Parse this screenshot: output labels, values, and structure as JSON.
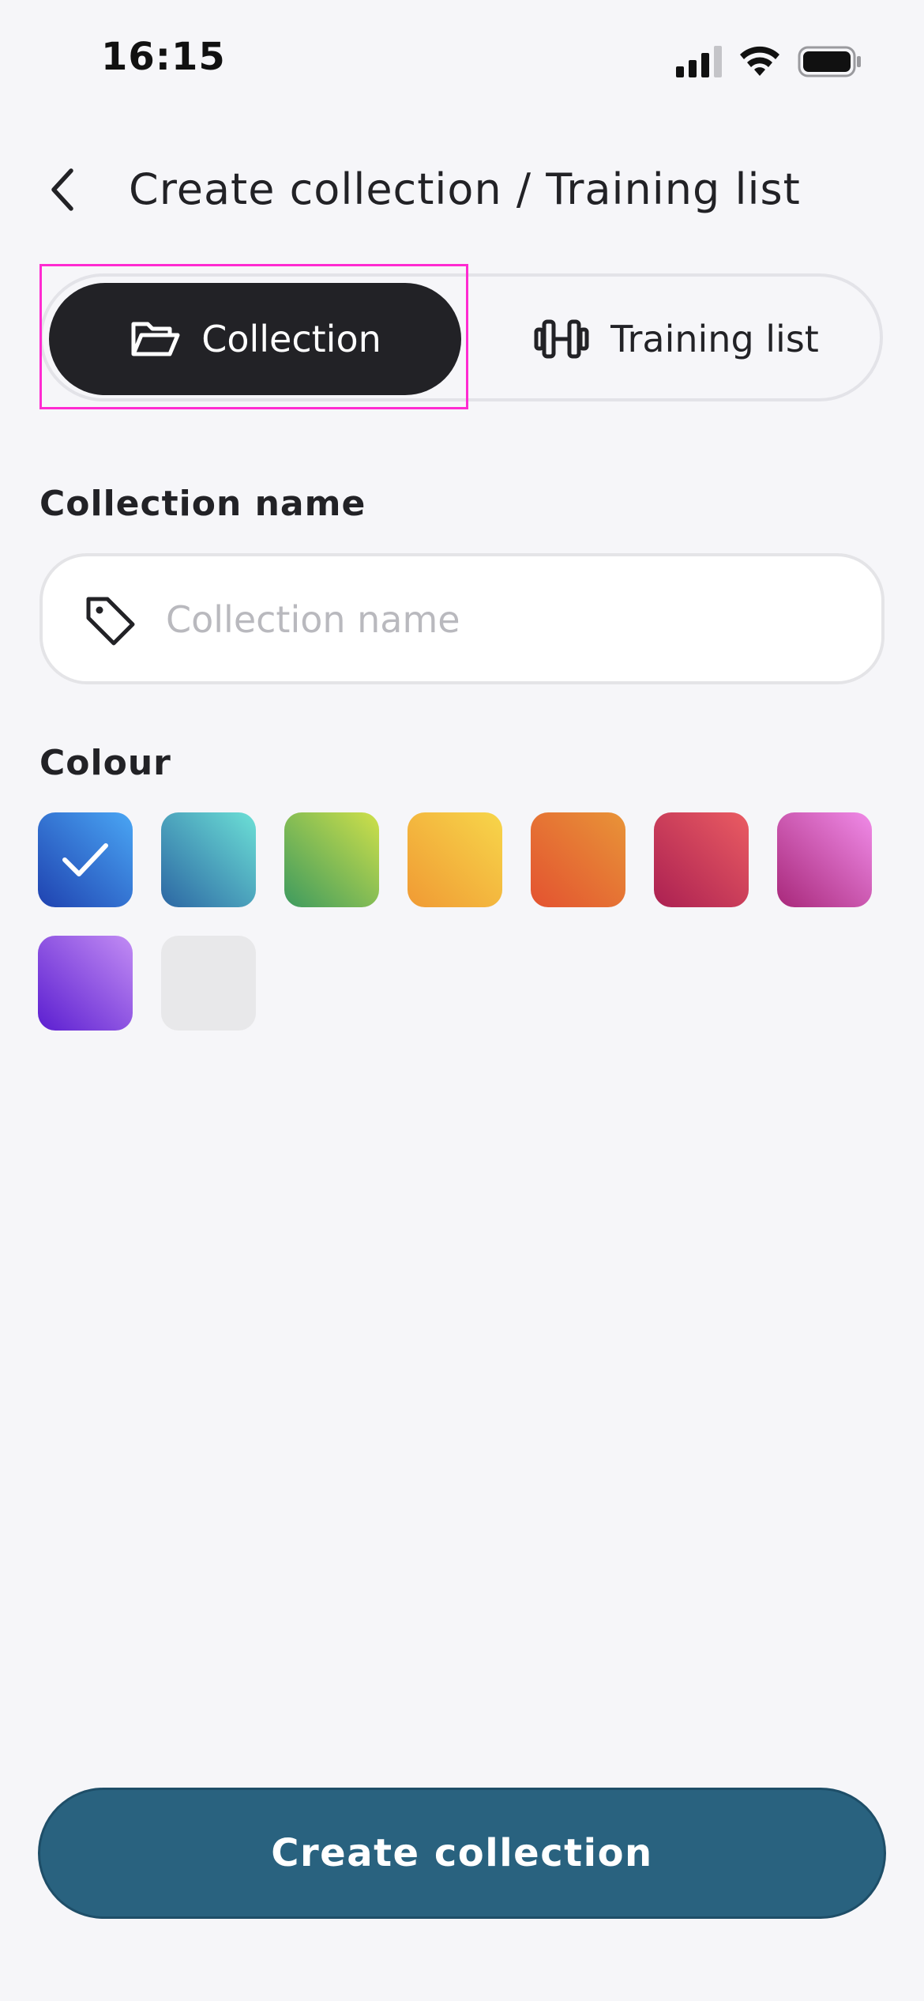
{
  "status_bar": {
    "time": "16:15",
    "icons": [
      "cellular-signal-icon",
      "wifi-icon",
      "battery-icon"
    ]
  },
  "header": {
    "title": "Create collection / Training list",
    "back_icon": "chevron-left-icon"
  },
  "segmented_control": {
    "selected": "collection",
    "options": [
      {
        "label": "Collection",
        "icon": "folder-open-icon"
      },
      {
        "label": "Training list",
        "icon": "dumbbell-icon"
      }
    ]
  },
  "form": {
    "name_label": "Collection name",
    "name_placeholder": "Collection name",
    "name_value": "",
    "name_icon": "tag-icon",
    "colour_label": "Colour",
    "colours": [
      {
        "name": "blue",
        "from": "#1f42b0",
        "to": "#4aa6f4",
        "selected": true
      },
      {
        "name": "teal",
        "from": "#2c66a3",
        "to": "#6ce0d6",
        "selected": false
      },
      {
        "name": "green",
        "from": "#3d9a5f",
        "to": "#cfe04a",
        "selected": false
      },
      {
        "name": "amber",
        "from": "#f09a34",
        "to": "#f7d64a",
        "selected": false
      },
      {
        "name": "orange",
        "from": "#e35230",
        "to": "#e89438",
        "selected": false
      },
      {
        "name": "red",
        "from": "#ab2052",
        "to": "#ea5c62",
        "selected": false
      },
      {
        "name": "pink",
        "from": "#a8287a",
        "to": "#f08be8",
        "selected": false
      },
      {
        "name": "purple",
        "from": "#5b1ed0",
        "to": "#c28cf4",
        "selected": false
      },
      {
        "name": "grey",
        "from": "#e8e8ea",
        "to": "#e8e8ea",
        "selected": false
      }
    ]
  },
  "footer": {
    "submit_label": "Create collection"
  },
  "colors": {
    "background": "#f6f6f9",
    "dark": "#222226",
    "primary": "#29627f",
    "highlight": "#ff2bd1"
  }
}
